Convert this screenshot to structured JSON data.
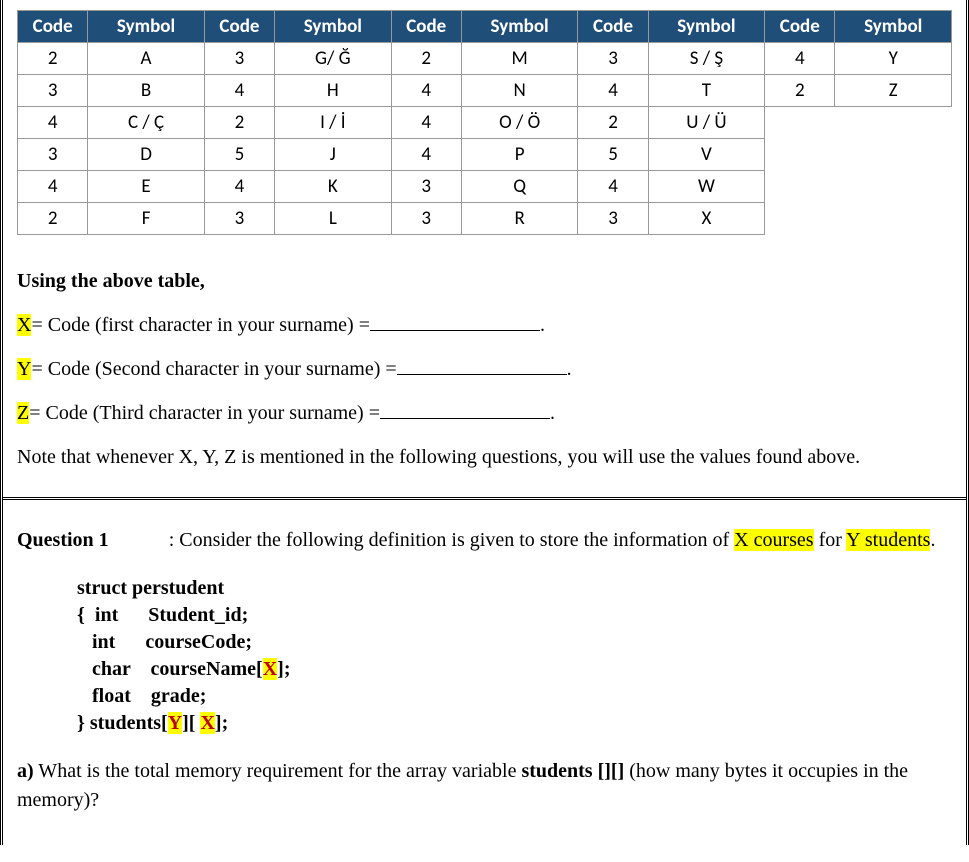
{
  "table": {
    "headers": [
      "Code",
      "Symbol",
      "Code",
      "Symbol",
      "Code",
      "Symbol",
      "Code",
      "Symbol",
      "Code",
      "Symbol"
    ],
    "rows": [
      [
        "2",
        "A",
        "3",
        "G/ Ğ",
        "2",
        "M",
        "3",
        "S / Ş",
        "4",
        "Y"
      ],
      [
        "3",
        "B",
        "4",
        "H",
        "4",
        "N",
        "4",
        "T",
        "2",
        "Z"
      ],
      [
        "4",
        "C / Ç",
        "2",
        "I / İ",
        "4",
        "O / Ö",
        "2",
        "U / Ü",
        "",
        ""
      ],
      [
        "3",
        "D",
        "5",
        "J",
        "4",
        "P",
        "5",
        "V",
        "",
        ""
      ],
      [
        "4",
        "E",
        "4",
        "K",
        "3",
        "Q",
        "4",
        "W",
        "",
        ""
      ],
      [
        "2",
        "F",
        "3",
        "L",
        "3",
        "R",
        "3",
        "X",
        "",
        ""
      ]
    ]
  },
  "instr": {
    "using": "Using the above table,",
    "x_var": "X",
    "x_txt": "= Code (first character in your surname) =",
    "y_var": "Y",
    "y_txt": "= Code (Second character in your surname) =",
    "z_var": "Z",
    "z_txt": "= Code (Third character in your surname) =",
    "period1": ".",
    "period2": ".",
    "period3": ".",
    "note": "Note that whenever X, Y, Z is mentioned in the following questions, you will use the values found above."
  },
  "q1": {
    "title": "Question 1",
    "colon_lead": ": Consider the following definition is given to store the information of ",
    "xcourses": "X courses",
    "for_txt": " for ",
    "ystudents": "Y students",
    "period": ".",
    "struct_line": "struct perstudent",
    "l_brace": "{",
    "int1_type": "int",
    "int1_name": "Student_id;",
    "int2_type": "int",
    "int2_name": "courseCode;",
    "char_type": "char",
    "char_name_pre": "courseName[",
    "char_X": "X",
    "char_name_post": "];",
    "float_type": "float",
    "float_name": "grade;",
    "r_brace_pre": "} students[",
    "arr_Y": "Y",
    "arr_mid": "][ ",
    "arr_X": "X",
    "arr_post": "];",
    "part_a_label": "a)",
    "part_a_txt1": " What is the total memory requirement for the array variable ",
    "part_a_bold": "students [][]",
    "part_a_txt2": " (how many bytes it occupies in the memory)?"
  }
}
